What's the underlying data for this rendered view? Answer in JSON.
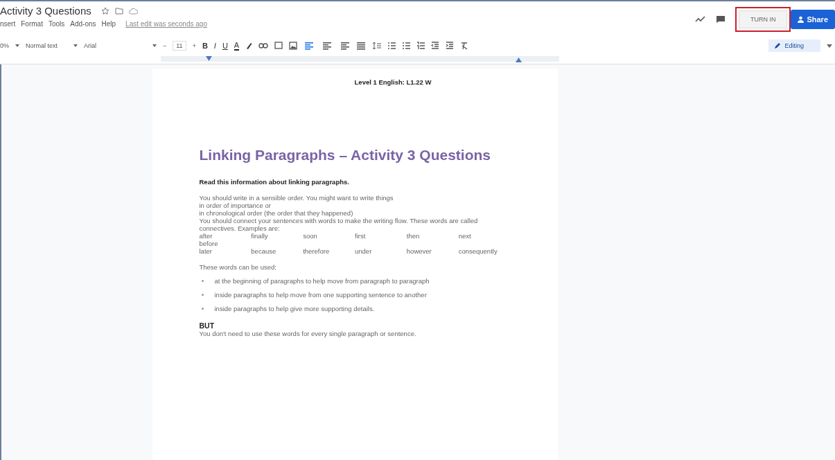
{
  "doc_title": "Activity 3 Questions",
  "menus": [
    "nsert",
    "Format",
    "Tools",
    "Add-ons",
    "Help"
  ],
  "last_edit": "Last edit was seconds ago",
  "toolbar": {
    "zoom": "0%",
    "style": "Normal text",
    "font": "Arial",
    "font_size": "11",
    "minus": "−",
    "plus": "+",
    "format_buttons": [
      "B",
      "I",
      "U",
      "A"
    ]
  },
  "align": [
    {
      "selected": true
    },
    {
      "selected": false
    },
    {
      "selected": false
    },
    {
      "selected": false
    }
  ],
  "turn_in": {
    "label": "TURN IN",
    "highlighted": true
  },
  "share": "Share",
  "mode": "Editing",
  "page": {
    "header": "Level 1 English: L1.22 W",
    "title": "Linking Paragraphs – Activity 3 Questions",
    "intro": "Read this information about linking paragraphs.",
    "lines": [
      "You should write in a sensible order. You might want to write things",
      "in order of importance or",
      "in chronological order (the order that they happened)",
      "You should connect your sentences with words to make the writing flow. These words are called connectives. Examples are:"
    ],
    "connectives": [
      [
        "after",
        "finally",
        "soon",
        "first",
        "then",
        "next"
      ],
      [
        "before"
      ],
      [
        "later",
        "because",
        "therefore",
        "under",
        "however",
        "consequently"
      ]
    ],
    "used_intro": "These words can be used:",
    "bullets": [
      "at the beginning of paragraphs to help move from paragraph to paragraph",
      "inside paragraphs to help move from one supporting sentence to another",
      "inside paragraphs to help give more supporting details."
    ],
    "but": "BUT",
    "closing": "You don't need to use these words for every single paragraph or sentence."
  }
}
